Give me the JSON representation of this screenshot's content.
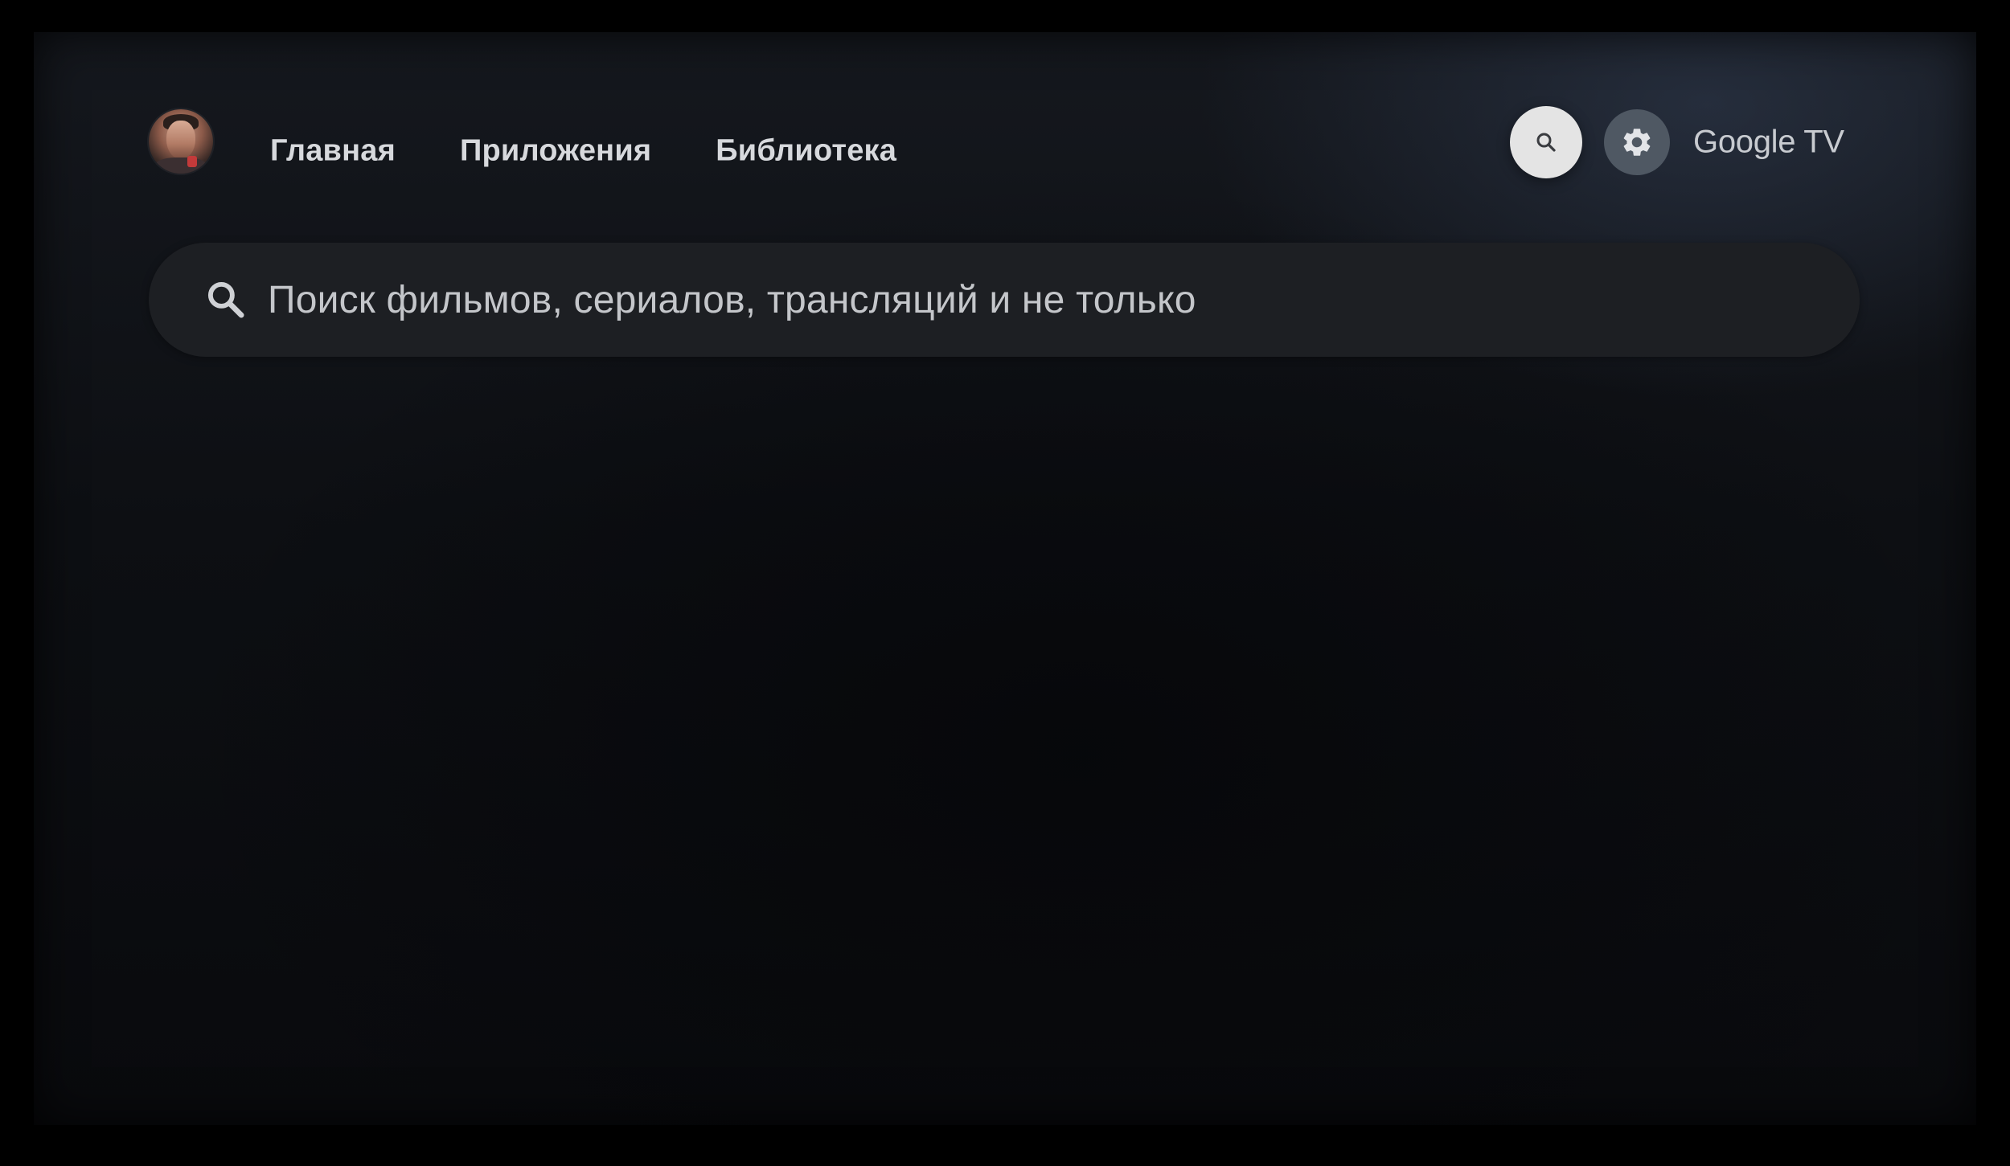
{
  "header": {
    "nav_tabs": [
      {
        "label": "Главная"
      },
      {
        "label": "Приложения"
      },
      {
        "label": "Библиотека"
      }
    ],
    "brand": "Google TV",
    "search_button_icon": "search-icon",
    "settings_button_icon": "gear-icon",
    "avatar": "profile-avatar"
  },
  "search": {
    "icon": "search-icon",
    "placeholder": "Поиск фильмов, сериалов, трансляций и не только"
  },
  "colors": {
    "background": "#0d0f13",
    "searchbar": "#1d1f23",
    "search_button": "#e4e4e4",
    "settings_button": "#4f5863",
    "text": "#d7d9dd"
  }
}
